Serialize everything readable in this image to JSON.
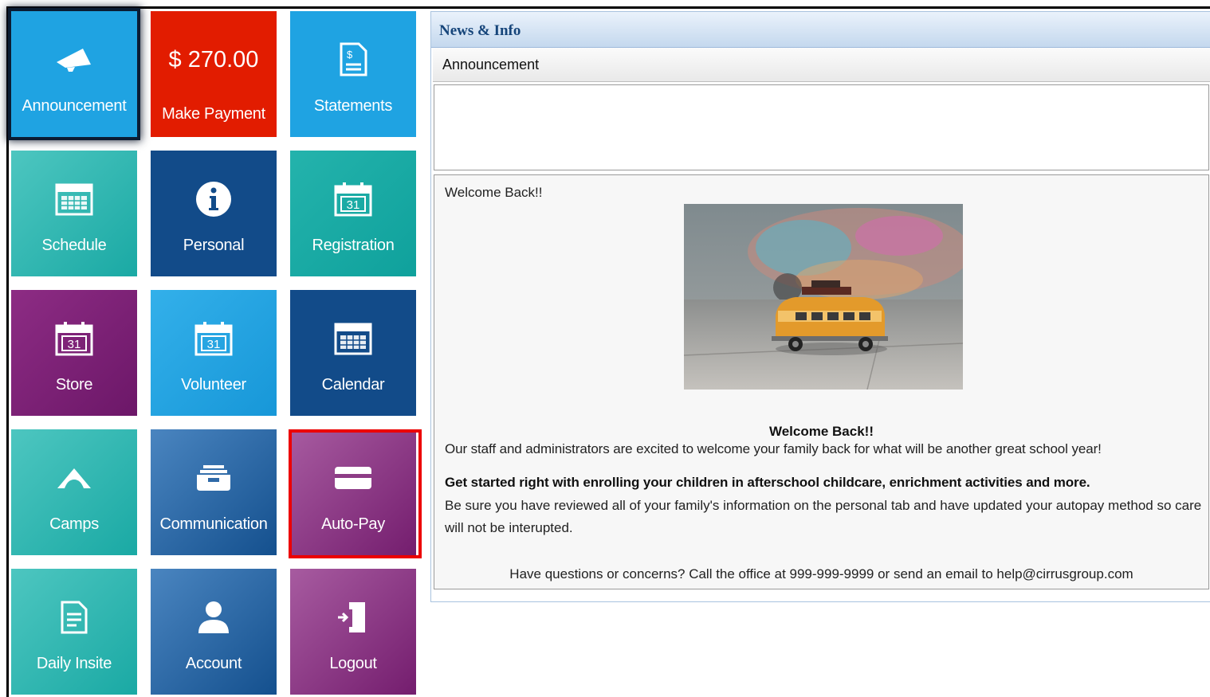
{
  "tiles": [
    {
      "name": "announcement",
      "label": "Announcement",
      "icon": "megaphone-icon"
    },
    {
      "name": "make-payment",
      "label": "Make Payment",
      "amount": "$ 270.00"
    },
    {
      "name": "statements",
      "label": "Statements",
      "icon": "document-dollar-icon"
    },
    {
      "name": "schedule",
      "label": "Schedule",
      "icon": "calendar-grid-icon"
    },
    {
      "name": "personal",
      "label": "Personal",
      "icon": "info-icon"
    },
    {
      "name": "registration",
      "label": "Registration",
      "icon": "calendar-31-icon",
      "icon_text": "31"
    },
    {
      "name": "store",
      "label": "Store",
      "icon": "calendar-31-icon",
      "icon_text": "31"
    },
    {
      "name": "volunteer",
      "label": "Volunteer",
      "icon": "calendar-31-icon",
      "icon_text": "31"
    },
    {
      "name": "calendar",
      "label": "Calendar",
      "icon": "calendar-grid-icon"
    },
    {
      "name": "camps",
      "label": "Camps",
      "icon": "tent-icon"
    },
    {
      "name": "communication",
      "label": "Communication",
      "icon": "inbox-tray-icon"
    },
    {
      "name": "auto-pay",
      "label": "Auto-Pay",
      "icon": "credit-card-icon"
    },
    {
      "name": "daily-insite",
      "label": "Daily Insite",
      "icon": "document-icon"
    },
    {
      "name": "account",
      "label": "Account",
      "icon": "user-icon"
    },
    {
      "name": "logout",
      "label": "Logout",
      "icon": "door-exit-icon"
    }
  ],
  "news": {
    "title": "News & Info",
    "section": "Announcement",
    "greeting": "Welcome Back!!",
    "heading": "Welcome Back!!",
    "para1": "Our staff and administrators are excited to welcome your family back for what will be another great school year!",
    "para2": "Get started right with enrolling your children in afterschool childcare, enrichment activities and more.",
    "para3": "Be sure you have reviewed all of your family's  information on the personal tab and have updated your autopay method so care will not be interupted.",
    "contact": "Have questions or concerns?  Call the office at 999-999-9999 or send an email to help@cirrusgroup.com"
  },
  "colors": {
    "payment_red": "#e21c00",
    "header_text": "#16457a",
    "highlight_border": "#ec0000"
  }
}
